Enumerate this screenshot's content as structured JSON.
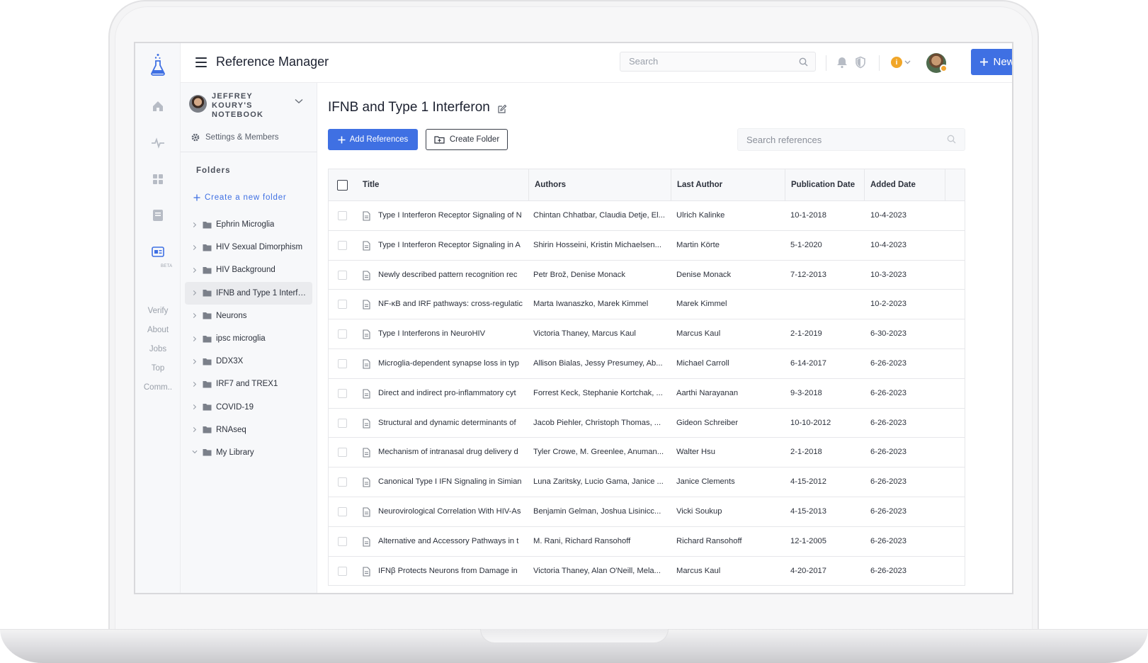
{
  "app": {
    "title": "Reference Manager",
    "search_placeholder": "Search",
    "new_button": "New",
    "accent_color": "#3f70e3"
  },
  "rail": {
    "beta_label": "BETA",
    "links": [
      "Verify",
      "About",
      "Jobs",
      "Top",
      "Comm.."
    ],
    "icons": [
      "flask-logo-icon",
      "home-icon",
      "activity-icon",
      "grid-icon",
      "notebook-icon",
      "reference-manager-icon"
    ]
  },
  "notebook": {
    "name": "JEFFREY KOURY'S NOTEBOOK",
    "settings_label": "Settings & Members"
  },
  "folders": {
    "label": "Folders",
    "create_label": "Create a new folder",
    "items": [
      {
        "label": "Ephrin Microglia",
        "active": false,
        "expanded": false
      },
      {
        "label": "HIV Sexual Dimorphism",
        "active": false,
        "expanded": false
      },
      {
        "label": "HIV Background",
        "active": false,
        "expanded": false
      },
      {
        "label": "IFNB and Type 1 Interfe...",
        "active": true,
        "expanded": false
      },
      {
        "label": "Neurons",
        "active": false,
        "expanded": false
      },
      {
        "label": "ipsc microglia",
        "active": false,
        "expanded": false
      },
      {
        "label": "DDX3X",
        "active": false,
        "expanded": false
      },
      {
        "label": "IRF7 and TREX1",
        "active": false,
        "expanded": false
      },
      {
        "label": "COVID-19",
        "active": false,
        "expanded": false
      },
      {
        "label": "RNAseq",
        "active": false,
        "expanded": false
      },
      {
        "label": "My Library",
        "active": false,
        "expanded": true
      }
    ]
  },
  "main": {
    "title": "IFNB and Type 1 Interferon",
    "add_references": "Add References",
    "create_folder": "Create Folder",
    "search_placeholder": "Search references"
  },
  "table": {
    "columns": [
      "Title",
      "Authors",
      "Last Author",
      "Publication Date",
      "Added Date"
    ],
    "rows": [
      {
        "title": "Type I Interferon Receptor Signaling of N",
        "authors": "Chintan Chhatbar, Claudia Detje, El...",
        "last": "Ulrich Kalinke",
        "pub": "10-1-2018",
        "added": "10-4-2023"
      },
      {
        "title": "Type I Interferon Receptor Signaling in A",
        "authors": "Shirin Hosseini, Kristin Michaelsen...",
        "last": "Martin Körte",
        "pub": "5-1-2020",
        "added": "10-4-2023"
      },
      {
        "title": "Newly described pattern recognition rec",
        "authors": "Petr Brož, Denise Monack",
        "last": "Denise Monack",
        "pub": "7-12-2013",
        "added": "10-3-2023"
      },
      {
        "title": "NF-κB and IRF pathways: cross-regulatic",
        "authors": "Marta Iwanaszko, Marek Kimmel",
        "last": "Marek Kimmel",
        "pub": "",
        "added": "10-2-2023"
      },
      {
        "title": "Type I Interferons in NeuroHIV",
        "authors": "Victoria Thaney, Marcus Kaul",
        "last": "Marcus Kaul",
        "pub": "2-1-2019",
        "added": "6-30-2023"
      },
      {
        "title": "Microglia-dependent synapse loss in typ",
        "authors": "Allison Bialas, Jessy Presumey, Ab...",
        "last": "Michael Carroll",
        "pub": "6-14-2017",
        "added": "6-26-2023"
      },
      {
        "title": "Direct and indirect pro-inflammatory cyt",
        "authors": "Forrest Keck, Stephanie Kortchak, ...",
        "last": "Aarthi Narayanan",
        "pub": "9-3-2018",
        "added": "6-26-2023"
      },
      {
        "title": "Structural and dynamic determinants of",
        "authors": "Jacob Piehler, Christoph Thomas, ...",
        "last": "Gideon Schreiber",
        "pub": "10-10-2012",
        "added": "6-26-2023"
      },
      {
        "title": "Mechanism of intranasal drug delivery d",
        "authors": "Tyler Crowe, M. Greenlee, Anuman...",
        "last": "Walter Hsu",
        "pub": "2-1-2018",
        "added": "6-26-2023"
      },
      {
        "title": "Canonical Type I IFN Signaling in Simian",
        "authors": "Luna Zaritsky, Lucio Gama, Janice ...",
        "last": "Janice Clements",
        "pub": "4-15-2012",
        "added": "6-26-2023"
      },
      {
        "title": "Neurovirological Correlation With HIV-As",
        "authors": "Benjamin Gelman, Joshua Lisinicc...",
        "last": "Vicki Soukup",
        "pub": "4-15-2013",
        "added": "6-26-2023"
      },
      {
        "title": "Alternative and Accessory Pathways in t",
        "authors": "M. Rani, Richard Ransohoff",
        "last": "Richard Ransohoff",
        "pub": "12-1-2005",
        "added": "6-26-2023"
      },
      {
        "title": "IFNβ Protects Neurons from Damage in",
        "authors": "Victoria Thaney, Alan O'Neill, Mela...",
        "last": "Marcus Kaul",
        "pub": "4-20-2017",
        "added": "6-26-2023"
      }
    ]
  }
}
